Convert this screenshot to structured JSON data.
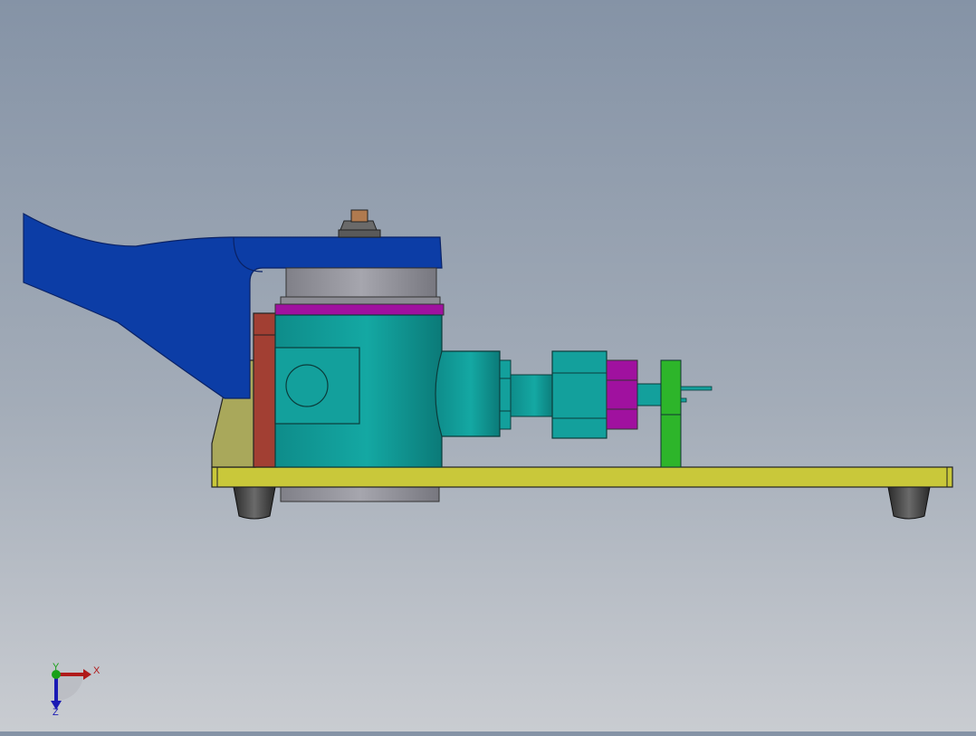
{
  "viewport": {
    "background_top": "#8593a6",
    "background_bottom": "#c9ccd1"
  },
  "colors": {
    "handle": "#0c3da6",
    "body": "#13a09c",
    "purple": "#a0119f",
    "red": "#a23f33",
    "olive": "#a9a85b",
    "base": "#c9c83a",
    "green": "#2db52a",
    "gray_cap": "#9a9aa2",
    "nut": "#b07a4f"
  },
  "triad": {
    "x_label": "X",
    "y_label": "Y",
    "z_label": "Z",
    "x_color": "#b01a1a",
    "y_color": "#19a019",
    "z_color": "#1a1ab4"
  }
}
